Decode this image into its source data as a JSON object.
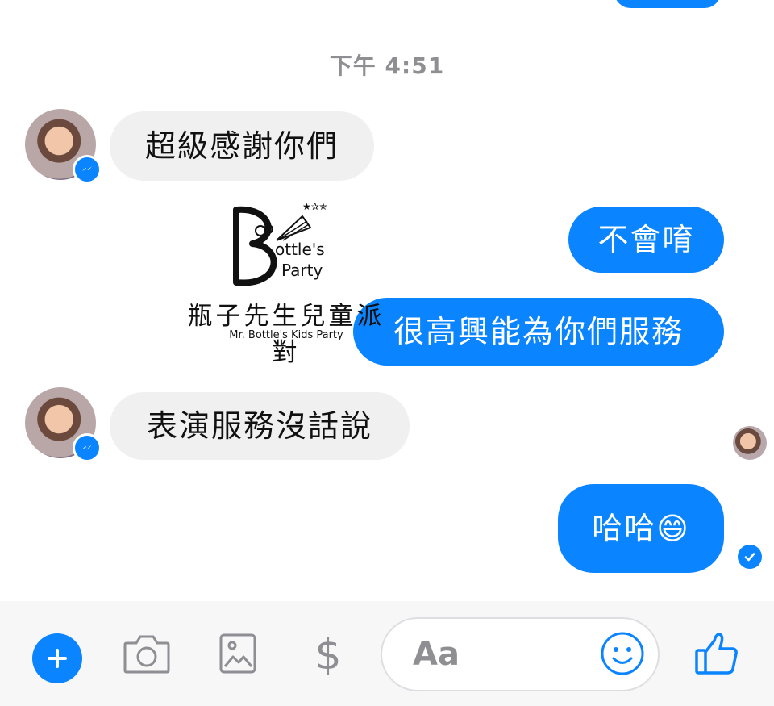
{
  "timestamp": "下午 4:51",
  "messages": [
    {
      "side": "incoming",
      "text": "超級感謝你們"
    },
    {
      "side": "outgoing",
      "text": "不會唷"
    },
    {
      "side": "outgoing",
      "text": "很高興能為你們服務"
    },
    {
      "side": "incoming",
      "text": "表演服務沒話說"
    },
    {
      "side": "outgoing",
      "text": "哈哈😄"
    }
  ],
  "watermark": {
    "title": "瓶子先生兒童派對",
    "subtitle": "Mr. Bottle's Kids Party",
    "logo_text": "ottle's Party"
  },
  "composer": {
    "placeholder": "Aa",
    "dollar_symbol": "$"
  },
  "colors": {
    "accent": "#0b84ff",
    "incoming_bubble": "#f0f0f0",
    "timestamp": "#8e8e93",
    "icon_gray": "#8e8e93"
  },
  "icons": [
    "messenger-badge-icon",
    "plus-icon",
    "camera-icon",
    "gallery-icon",
    "dollar-icon",
    "emoji-icon",
    "thumbs-up-icon",
    "delivered-check-icon"
  ]
}
